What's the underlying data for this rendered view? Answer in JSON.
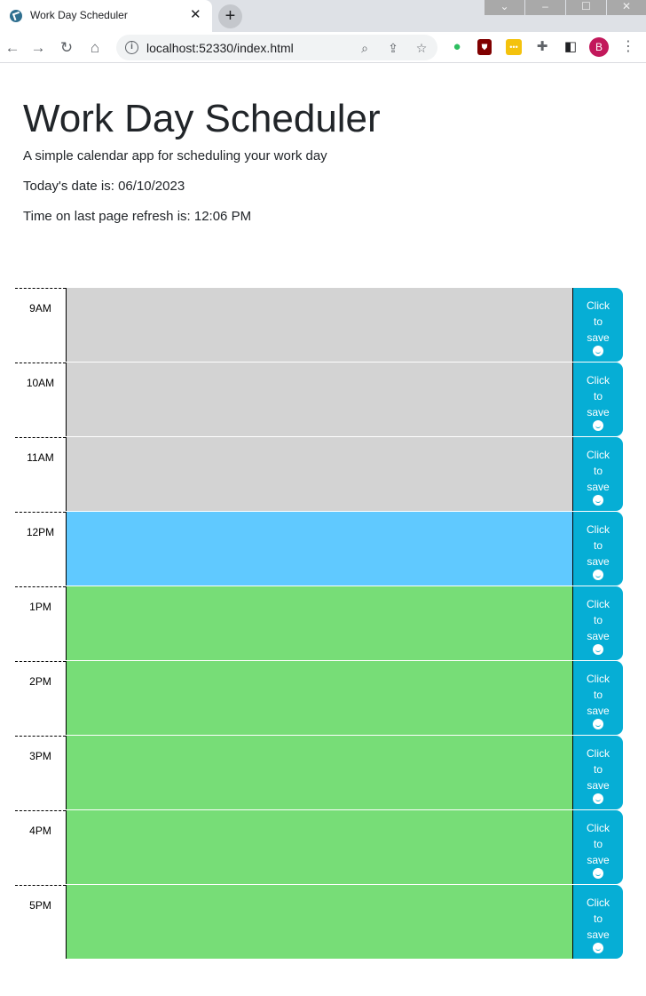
{
  "browser": {
    "tab_title": "Work Day Scheduler",
    "new_tab_label": "+",
    "url": "localhost:52330/index.html",
    "profile_initial": "B"
  },
  "header": {
    "title": "Work Day Scheduler",
    "subtitle": "A simple calendar app for scheduling your work day",
    "date_line": "Today's date is: 06/10/2023",
    "time_line": "Time on last page refresh is: 12:06 PM"
  },
  "schedule": {
    "save_button_label": "Click to save",
    "rows": [
      {
        "hour": "9AM",
        "status": "past",
        "text": ""
      },
      {
        "hour": "10AM",
        "status": "past",
        "text": ""
      },
      {
        "hour": "11AM",
        "status": "past",
        "text": ""
      },
      {
        "hour": "12PM",
        "status": "present",
        "text": ""
      },
      {
        "hour": "1PM",
        "status": "future",
        "text": ""
      },
      {
        "hour": "2PM",
        "status": "future",
        "text": ""
      },
      {
        "hour": "3PM",
        "status": "future",
        "text": ""
      },
      {
        "hour": "4PM",
        "status": "future",
        "text": ""
      },
      {
        "hour": "5PM",
        "status": "future",
        "text": ""
      }
    ]
  },
  "colors": {
    "past": "#d3d3d3",
    "present": "#60c9ff",
    "future": "#77dd77",
    "save_button": "#06aed5"
  }
}
